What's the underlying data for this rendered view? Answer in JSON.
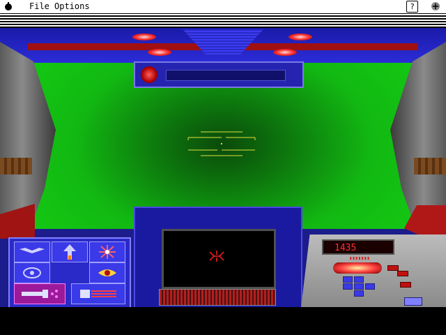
{
  "menubar": {
    "items": [
      "File",
      "Options"
    ],
    "help_label": "?",
    "icons": {
      "apple": "apple-icon",
      "app": "app-icon"
    }
  },
  "hud": {
    "weapons": [
      {
        "name": "wings-icon",
        "active": false
      },
      {
        "name": "missile-up-icon",
        "active": false
      },
      {
        "name": "starburst-icon",
        "active": false
      },
      {
        "name": "emblem-icon",
        "active": false
      },
      {
        "name": "eye-icon",
        "active": false
      },
      {
        "name": "laser-icon",
        "active": true
      },
      {
        "name": "cannon-icon",
        "active": false
      }
    ],
    "readout_value": "1435",
    "colors": {
      "viewport": "#14d014",
      "frame": "#2c2cd8",
      "alert": "#ff3030",
      "reticle": "#e0e040"
    }
  }
}
